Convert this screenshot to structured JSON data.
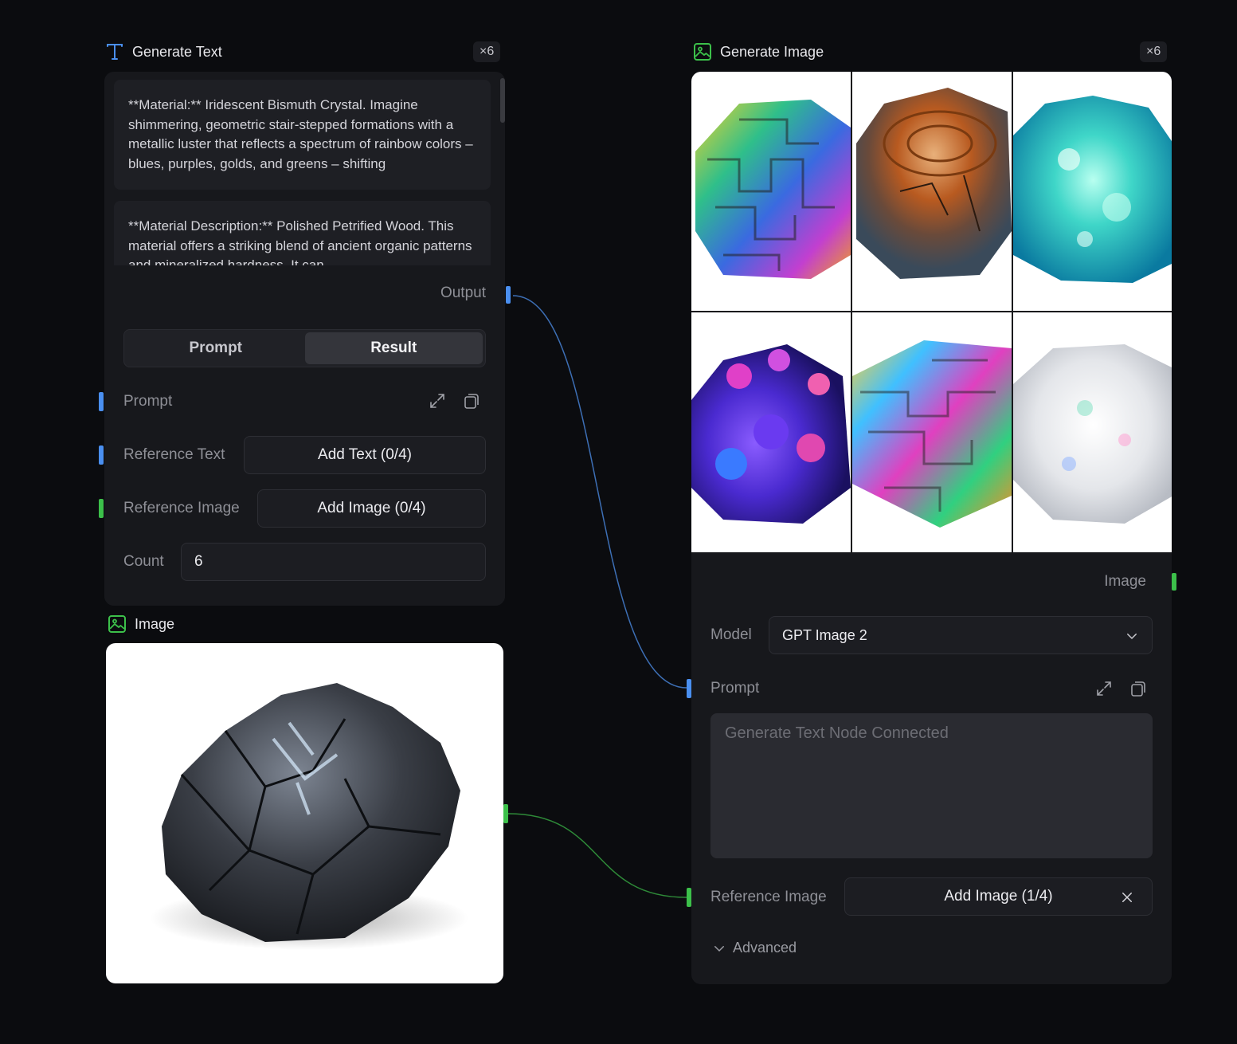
{
  "generate_text": {
    "title": "Generate Text",
    "count_badge": "×6",
    "results": [
      "**Material:** Iridescent Bismuth Crystal. Imagine shimmering, geometric stair-stepped formations with a metallic luster that reflects a spectrum of rainbow colors – blues, purples, golds, and greens – shifting",
      "**Material Description:** Polished Petrified Wood. This material offers a striking blend of ancient organic patterns and mineralized hardness. It can"
    ],
    "output_label": "Output",
    "tabs": [
      "Prompt",
      "Result"
    ],
    "active_tab": "Result",
    "prompt_label": "Prompt",
    "reference_text_label": "Reference Text",
    "add_text_button": "Add Text (0/4)",
    "reference_image_label": "Reference Image",
    "add_image_button": "Add Image (0/4)",
    "count_label": "Count",
    "count_value": "6"
  },
  "image_node": {
    "title": "Image"
  },
  "generate_image": {
    "title": "Generate Image",
    "count_badge": "×6",
    "thumbnails": [
      "bismuth-crystal",
      "petrified-wood",
      "aqua-crystal",
      "coral-geode",
      "bismuth-block",
      "opal"
    ],
    "image_output_label": "Image",
    "model_label": "Model",
    "model_value": "GPT Image 2",
    "prompt_label": "Prompt",
    "prompt_placeholder": "Generate Text Node Connected",
    "reference_image_label": "Reference Image",
    "add_image_button": "Add Image (1/4)",
    "advanced_label": "Advanced"
  },
  "colors": {
    "text_accent": "#4a8ff0",
    "image_accent": "#3cc04a",
    "background": "#0b0c0f",
    "panel": "#17181c"
  },
  "icons": [
    "text-t-icon",
    "image-icon",
    "expand-icon",
    "copy-icon",
    "chevron-down-icon",
    "close-icon"
  ]
}
